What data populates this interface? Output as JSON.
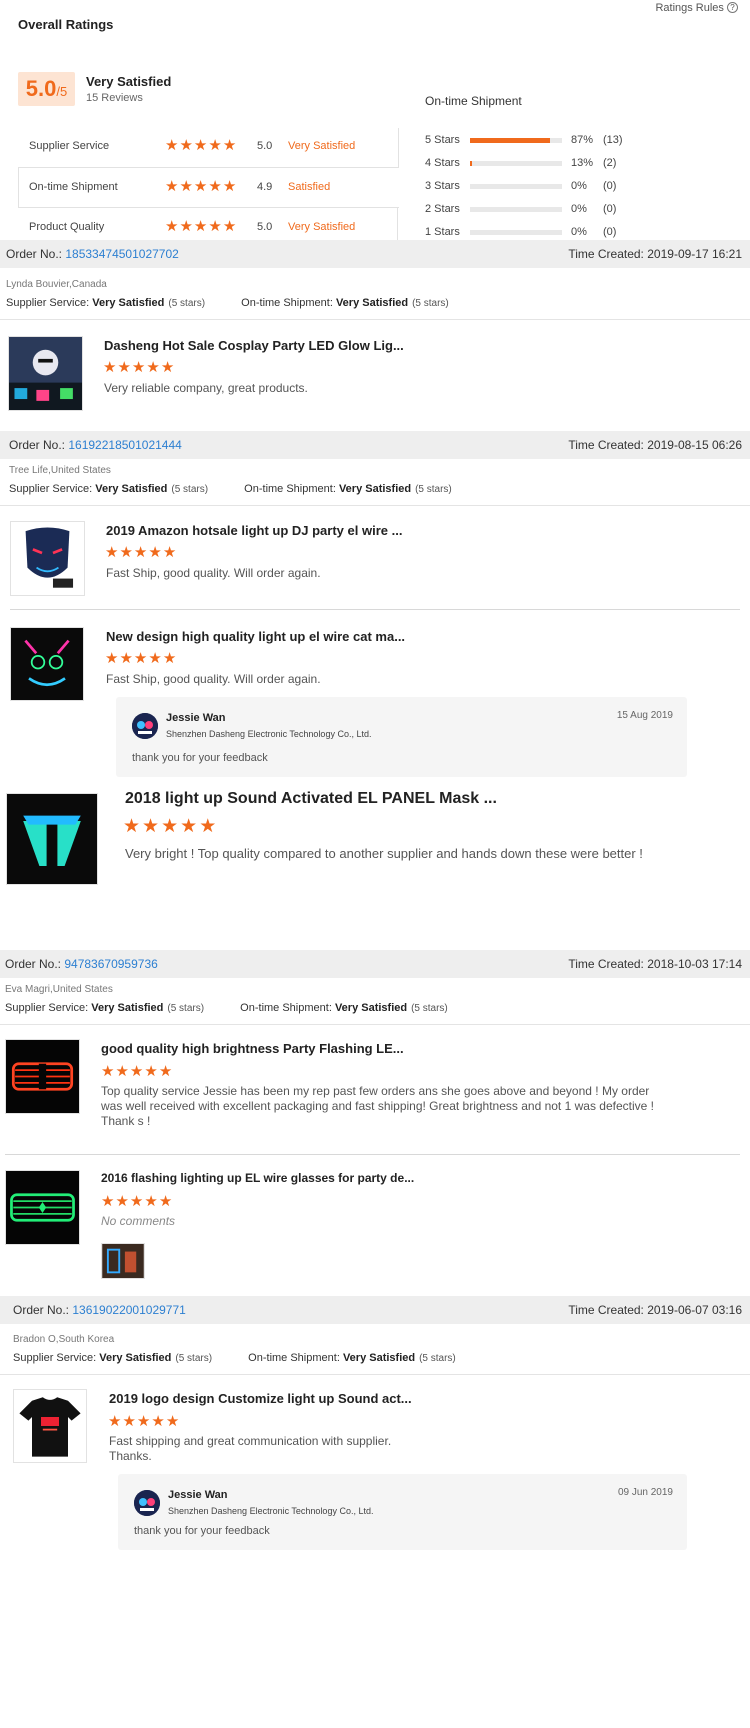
{
  "header": {
    "title": "Overall Ratings",
    "rules_label": "Ratings Rules",
    "help_icon": "help-circle-icon"
  },
  "summary": {
    "score": "5.0",
    "score_suffix": "/5",
    "satisfaction": "Very Satisfied",
    "reviews": "15 Reviews",
    "categories": [
      {
        "label": "Supplier Service",
        "score": "5.0",
        "level": "Very Satisfied",
        "stars": 5
      },
      {
        "label": "On-time Shipment",
        "score": "4.9",
        "level": "Satisfied",
        "stars": 5
      },
      {
        "label": "Product Quality",
        "score": "5.0",
        "level": "Very Satisfied",
        "stars": 5
      }
    ]
  },
  "distribution": {
    "title": "On-time Shipment",
    "rows": [
      {
        "label": "5 Stars",
        "pct": "87%",
        "count": "(13)",
        "fraction": 0.87
      },
      {
        "label": "4 Stars",
        "pct": "13%",
        "count": "(2)",
        "fraction": 0.02
      },
      {
        "label": "3 Stars",
        "pct": "0%",
        "count": "(0)",
        "fraction": 0
      },
      {
        "label": "2 Stars",
        "pct": "0%",
        "count": "(0)",
        "fraction": 0
      },
      {
        "label": "1 Stars",
        "pct": "0%",
        "count": "(0)",
        "fraction": 0
      }
    ]
  },
  "labels": {
    "order_no": "Order No.:",
    "time_created": "Time Created:",
    "supplier_service": "Supplier Service:",
    "ontime_shipment": "On-time Shipment:",
    "very_satisfied": "Very Satisfied",
    "five_stars": "(5 stars)"
  },
  "orders": [
    {
      "order_no": "18533474501027702",
      "time": "2019-09-17 16:21",
      "buyer": "Lynda Bouvier,Canada",
      "items": [
        {
          "name": "Dasheng Hot Sale Cosplay Party LED Glow Lig...",
          "comment": "Very reliable company, great products."
        }
      ]
    },
    {
      "order_no": "16192218501021444",
      "time": "2019-08-15 06:26",
      "buyer": "Tree Life,United States",
      "items": [
        {
          "name": "2019 Amazon hotsale light up DJ party el wire ...",
          "comment": "Fast Ship, good quality. Will order again."
        },
        {
          "name": "New design high quality light up el wire cat ma...",
          "comment": "Fast Ship, good quality. Will order again."
        },
        {
          "name": "2018 light up Sound Activated EL PANEL Mask ...",
          "comment": "Very bright ! Top quality compared to another supplier and hands down these were better !"
        }
      ],
      "reply": {
        "name": "Jessie Wan",
        "company": "Shenzhen Dasheng Electronic Technology Co., Ltd.",
        "date": "15 Aug 2019",
        "text": "thank you for your feedback"
      }
    },
    {
      "order_no": "94783670959736",
      "time": "2018-10-03 17:14",
      "buyer": "Eva Magri,United States",
      "items": [
        {
          "name": "good quality high brightness Party Flashing LE...",
          "comment": "Top quality service Jessie has been my rep past few orders ans she goes above and beyond ! My order was well received with excellent packaging and fast shipping! Great brightness and not 1 was defective ! Thank s !"
        },
        {
          "name": "2016 flashing lighting up EL wire glasses for party de...",
          "comment": "No comments"
        }
      ]
    },
    {
      "order_no": "13619022001029771",
      "time": "2019-06-07 03:16",
      "buyer": "Bradon O,South Korea",
      "items": [
        {
          "name": "2019 logo design Customize light up Sound act...",
          "comment": "Fast shipping and great communication with supplier. Thanks."
        }
      ],
      "reply": {
        "name": "Jessie Wan",
        "company": "Shenzhen Dasheng Electronic Technology Co., Ltd.",
        "date": "09 Jun 2019",
        "text": "thank you for your feedback"
      }
    }
  ],
  "colors": {
    "accent": "#f06a1c",
    "link": "#2c7fd1",
    "bar_bg": "#eeeeee"
  }
}
